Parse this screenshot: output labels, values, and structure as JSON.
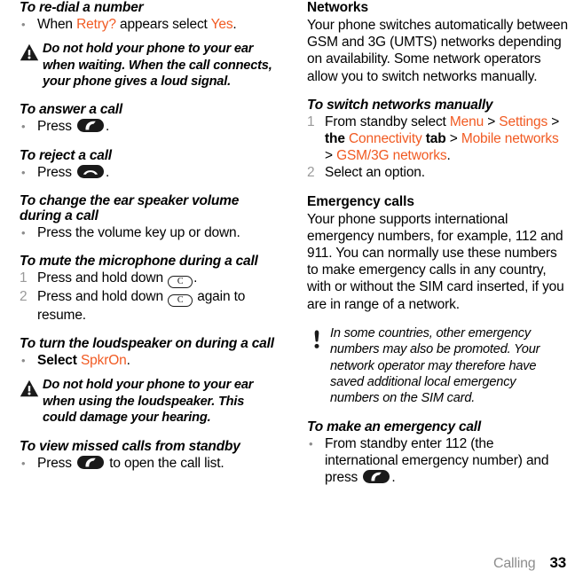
{
  "document": {
    "footer": {
      "chapter": "Calling",
      "page_number": "33"
    },
    "colors": {
      "highlight": "#f15a22",
      "bullet": "#8c8c8c",
      "number": "#9a9a9a",
      "footer_chapter": "#8d8d8d",
      "text": "#000000",
      "key_fill": "#1a1a1a"
    }
  },
  "left_column": {
    "redial": {
      "heading": "To re-dial a number",
      "item_pre": "When ",
      "item_hl1": "Retry?",
      "item_mid": " appears select ",
      "item_hl2": "Yes",
      "item_end": "."
    },
    "warning_1": {
      "icon": "warning-triangle-icon",
      "text": "Do not hold your phone to your ear when waiting. When the call connects, your phone gives a loud signal."
    },
    "answer": {
      "heading": "To answer a call",
      "item_pre": "Press ",
      "item_key": "call-key-icon",
      "item_end": "."
    },
    "reject": {
      "heading": "To reject a call",
      "item_pre": "Press ",
      "item_key": "end-call-key-icon",
      "item_end": "."
    },
    "volume": {
      "heading": "To change the ear speaker volume during a call",
      "item": "Press the volume key up or down."
    },
    "mute": {
      "heading": "To mute the microphone during a call",
      "step1_pre": "Press and hold down ",
      "step1_key": "C",
      "step1_end": ".",
      "step2_pre": "Press and hold down ",
      "step2_key": "C",
      "step2_end": " again to resume."
    },
    "loudspeaker": {
      "heading": "To turn the loudspeaker on during a call",
      "item_pre": "Select ",
      "item_hl": "SpkrOn",
      "item_end": "."
    },
    "warning_2": {
      "icon": "warning-triangle-icon",
      "text": "Do not hold your phone to your ear when using the loudspeaker. This could damage your hearing."
    },
    "missed_calls": {
      "heading": "To view missed calls from standby",
      "item_pre": "Press ",
      "item_key": "call-key-icon",
      "item_end": " to open the call list."
    }
  },
  "right_column": {
    "networks": {
      "heading": "Networks",
      "body": "Your phone switches automatically between GSM and 3G (UMTS) networks depending on availability. Some network operators allow you to switch networks manually."
    },
    "switch_networks": {
      "heading": "To switch networks manually",
      "step1_pre": "From standby select ",
      "step1_hl1": "Menu",
      "step1_sep1": " > ",
      "step1_hl2": "Settings",
      "step1_sep2": " > ",
      "step1_bold1": "the",
      "step1_space1": " ",
      "step1_hl3": "Connectivity",
      "step1_space2": " ",
      "step1_bold2": "tab",
      "step1_sep3": " > ",
      "step1_hl4": "Mobile networks",
      "step1_sep4": " > ",
      "step1_hl5": "GSM/3G networks",
      "step1_end": ".",
      "step2": "Select an option."
    },
    "emergency": {
      "heading": "Emergency calls",
      "body": "Your phone supports international emergency numbers, for example, 112 and 911. You can normally use these numbers to make emergency calls in any country, with or without the SIM card inserted, if you are in range of a network."
    },
    "note": {
      "icon": "exclamation-note-icon",
      "text": "In some countries, other emergency numbers may also be promoted. Your network operator may therefore have saved additional local emergency numbers on the SIM card."
    },
    "make_emergency": {
      "heading": "To make an emergency call",
      "item_pre": "From standby enter 112 (the international emergency number) and press ",
      "item_key": "call-key-icon",
      "item_end": "."
    }
  }
}
